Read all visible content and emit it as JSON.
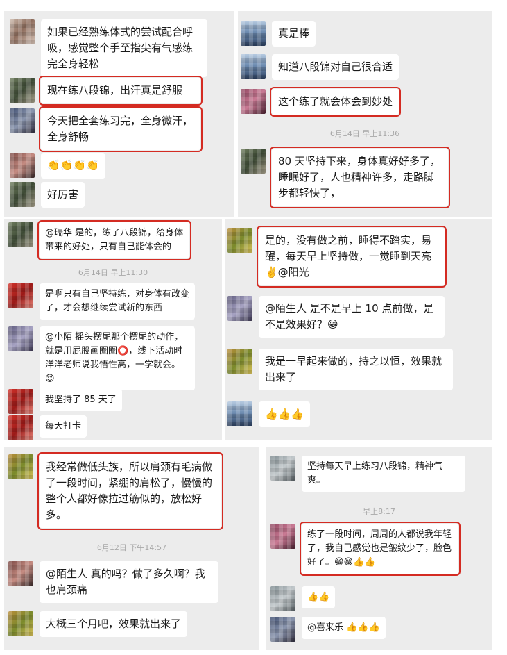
{
  "panels": {
    "p1": {
      "m1": "如果已经熟练体式的尝试配合呼吸，感觉整个手至指尖有气感练完全身轻松",
      "m2": "现在练八段锦，出汗真是舒服",
      "m3": "今天把全套练习完，全身微汗，全身舒畅",
      "m4": "👏👏👏👏",
      "m5": "好厉害"
    },
    "p2": {
      "m1": "真是棒",
      "m2": "知道八段锦对自己很合适",
      "m3": "这个练了就会体会到妙处",
      "ts": "6月14日 早上11:36",
      "m4": "80 天坚持下来，身体真好好多了，睡眠好了，人也精神许多，走路脚步都轻快了，"
    },
    "p3": {
      "m1": "@瑞华 是的，练了八段锦，给身体带来的好处，只有自己能体会的",
      "ts": "6月14日 早上11:30",
      "m2": "是啊只有自己坚持练，对身体有改变了，才会想继续尝试新的东西",
      "m3": "@小陌 摇头摆尾那个摆尾的动作，就是用屁股画圈圈⭕，线下活动时洋洋老师说我悟性高，一学就会。😌",
      "m4": "我坚持了 85 天了",
      "m5": "每天打卡"
    },
    "p4": {
      "m1": "是的，没有做之前，睡得不踏实，易醒，每天早上坚持做，一觉睡到天亮✌️@阳光",
      "m2": "@陌生人 是不是早上 10 点前做，是不是效果好？😁",
      "m3": "我是一早起来做的，持之以恒，效果就出来了",
      "m4": "👍👍👍"
    },
    "p5": {
      "m1": "我经常做低头族，所以肩颈有毛病做了一段时间，紧绷的肩松了，慢慢的整个人都好像拉过筋似的，放松好多。",
      "ts": "6月12日 下午14:57",
      "m2": "@陌生人 真的吗？做了多久啊？我也肩颈痛",
      "m3": "大概三个月吧，效果就出来了"
    },
    "p6": {
      "m1": "坚持每天早上练习八段锦，精神气爽。",
      "ts": "早上8:17",
      "m2": "练了一段时间，周周的人都说我年轻了，我自己感觉也是皱纹少了，脸色好了。😁😁👍👍",
      "m3": "👍👍",
      "m4": "@喜来乐 👍👍👍"
    }
  },
  "colors": {
    "highlight": "#d42b22",
    "panel_bg": "#ececec",
    "bubble_bg": "#ffffff"
  }
}
